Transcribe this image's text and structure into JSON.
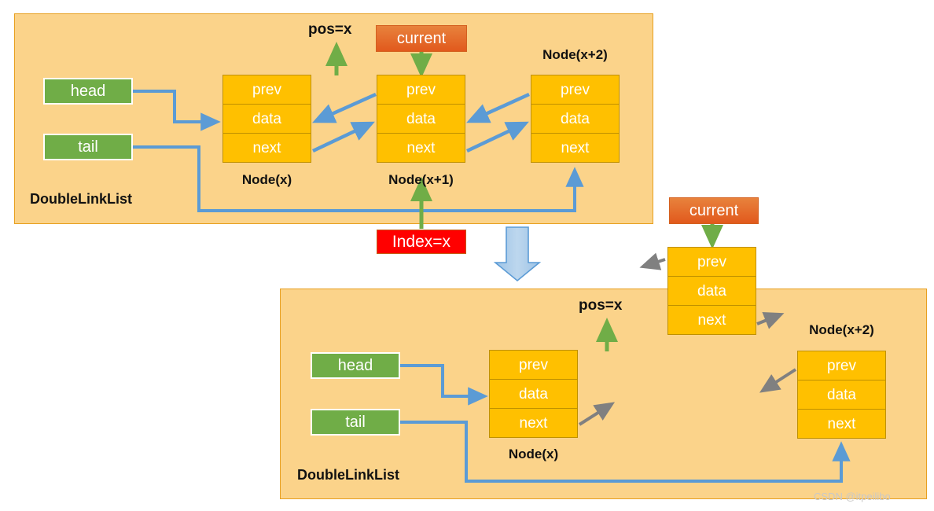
{
  "diagram": {
    "title": "DoubleLinkList remove-at-index illustration",
    "watermark": "CSDN @itpeilibo",
    "colors": {
      "panel_fill": "#fbd38a",
      "panel_border": "#e8a020",
      "node_fill": "#ffc000",
      "node_border": "#bf9000",
      "pointer_green": "#70ad47",
      "current_orange": "#e1591d",
      "index_red": "#ff0000",
      "link_blue": "#5b9bd5",
      "detached_gray": "#808080",
      "arrow_green": "#70ad47"
    },
    "cell_labels": [
      "prev",
      "data",
      "next"
    ]
  },
  "top": {
    "panel_label": "DoubleLinkList",
    "head_label": "head",
    "tail_label": "tail",
    "pos_label": "pos=x",
    "current_label": "current",
    "index_label": "Index=x",
    "nodes": [
      {
        "name": "Node(x)",
        "cells": [
          "prev",
          "data",
          "next"
        ]
      },
      {
        "name": "Node(x+1)",
        "cells": [
          "prev",
          "data",
          "next"
        ]
      },
      {
        "name": "Node(x+2)",
        "cells": [
          "prev",
          "data",
          "next"
        ]
      }
    ]
  },
  "transition": {
    "arrow": "down-arrow"
  },
  "detached": {
    "current_label": "current",
    "node": {
      "name": "",
      "cells": [
        "prev",
        "data",
        "next"
      ]
    }
  },
  "bottom": {
    "panel_label": "DoubleLinkList",
    "head_label": "head",
    "tail_label": "tail",
    "pos_label": "pos=x",
    "nodes": [
      {
        "name": "Node(x)",
        "cells": [
          "prev",
          "data",
          "next"
        ]
      },
      {
        "name": "Node(x+2)",
        "cells": [
          "prev",
          "data",
          "next"
        ]
      }
    ]
  }
}
